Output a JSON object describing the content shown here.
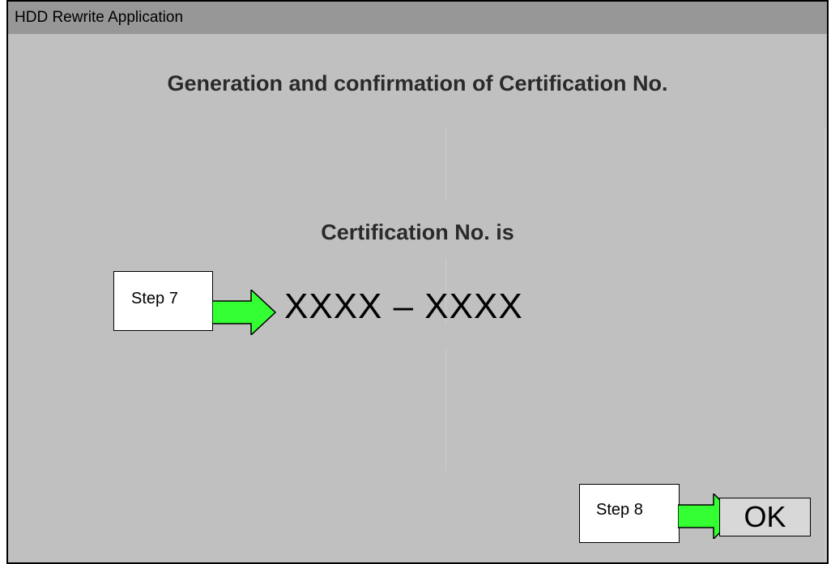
{
  "window": {
    "title": "HDD Rewrite Application"
  },
  "main": {
    "heading": "Generation and confirmation of Certification No.",
    "cert_label": "Certification No. is",
    "cert_number": "XXXX – XXXX"
  },
  "annotations": {
    "step7_label": "Step 7",
    "step8_label": "Step 8",
    "arrow_color": "#33ff33"
  },
  "buttons": {
    "ok_label": "OK"
  }
}
